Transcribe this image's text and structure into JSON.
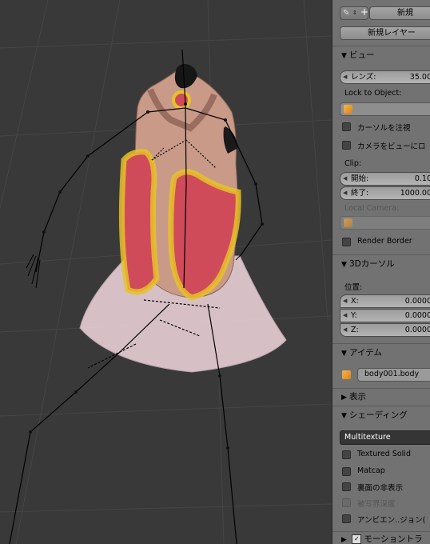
{
  "toolbar": {
    "new_label": "新規",
    "new_layer_label": "新規レイヤー"
  },
  "view_section": {
    "header": "ビュー",
    "lens_label": "レンズ:",
    "lens_value": "35.00",
    "lock_to_object_label": "Lock to Object:",
    "cursor_check_label": "カーソルを注視",
    "camera_check_label": "カメラをビューにロ",
    "clip_label": "Clip:",
    "clip_start_label": "開始:",
    "clip_start_value": "0.10",
    "clip_end_label": "終了:",
    "clip_end_value": "1000.00",
    "local_camera_label": "Local Camera:",
    "render_border_label": "Render Border"
  },
  "cursor_section": {
    "header": "3Dカーソル",
    "location_label": "位置:",
    "x_label": "X:",
    "x_value": "0.0000",
    "y_label": "Y:",
    "y_value": "0.0000",
    "z_label": "Z:",
    "z_value": "0.0000"
  },
  "item_section": {
    "header": "アイテム",
    "object_name": "body001.body"
  },
  "display_section": {
    "header": "表示"
  },
  "shading_section": {
    "header": "シェーディング",
    "mode": "Multitexture",
    "textured_solid_label": "Textured Solid",
    "matcap_label": "Matcap",
    "backface_label": "裏面の非表示",
    "dof_label": "被写界深度",
    "ao_label": "アンビエン..ジョン("
  },
  "motion_section": {
    "header": "モーショントラ"
  },
  "colors": {
    "panel_bg": "#727272",
    "viewport_bg": "#393939",
    "highlight": "#e6c229",
    "accent": "#f0a030"
  }
}
